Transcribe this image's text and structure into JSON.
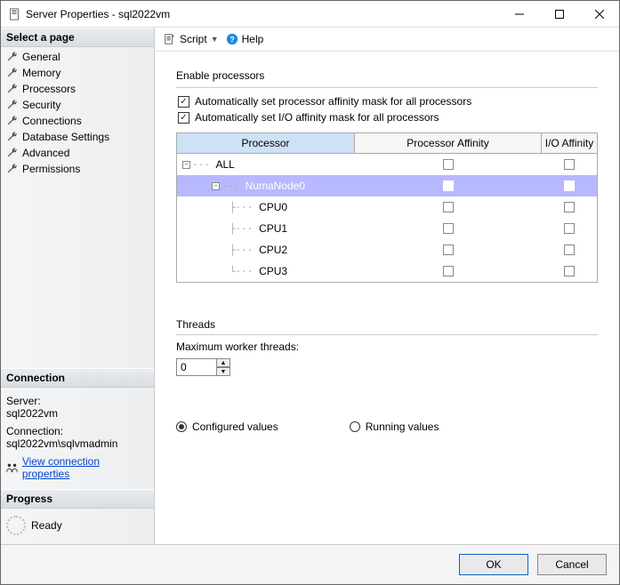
{
  "window": {
    "title": "Server Properties - sql2022vm"
  },
  "sidebar": {
    "select_page_label": "Select a page",
    "pages": {
      "general": "General",
      "memory": "Memory",
      "processors": "Processors",
      "security": "Security",
      "connections": "Connections",
      "database_settings": "Database Settings",
      "advanced": "Advanced",
      "permissions": "Permissions"
    },
    "connection_header": "Connection",
    "server_label": "Server:",
    "server_value": "sql2022vm",
    "connection_label": "Connection:",
    "connection_value": "sql2022vm\\sqlvmadmin",
    "view_props_link": "View connection properties",
    "progress_header": "Progress",
    "progress_status": "Ready"
  },
  "toolbar": {
    "script": "Script",
    "help": "Help"
  },
  "processors": {
    "group_label": "Enable processors",
    "auto_processor_affinity": "Automatically set processor affinity mask for all processors",
    "auto_io_affinity": "Automatically set I/O affinity mask for all processors",
    "columns": {
      "processor": "Processor",
      "proc_affinity": "Processor Affinity",
      "io_affinity": "I/O Affinity"
    },
    "rows": {
      "all": "ALL",
      "numa0": "NumaNode0",
      "cpu0": "CPU0",
      "cpu1": "CPU1",
      "cpu2": "CPU2",
      "cpu3": "CPU3"
    }
  },
  "threads": {
    "group_label": "Threads",
    "max_worker_label": "Maximum worker threads:",
    "value": "0"
  },
  "radios": {
    "configured": "Configured  values",
    "running": "Running values"
  },
  "buttons": {
    "ok": "OK",
    "cancel": "Cancel"
  }
}
